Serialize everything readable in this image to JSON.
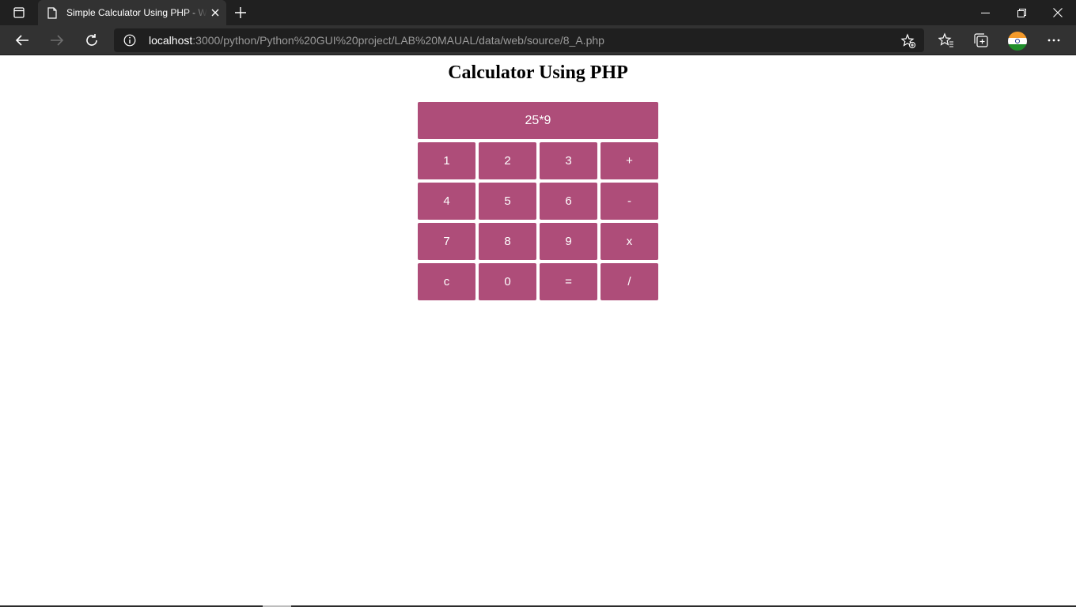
{
  "browser": {
    "tab_title": "Simple Calculator Using PHP - W",
    "url_host": "localhost",
    "url_rest": ":3000/python/Python%20GUI%20project/LAB%20MAUAL/data/web/source/8_A.php"
  },
  "page": {
    "title": "Calculator Using PHP"
  },
  "calculator": {
    "display": "25*9",
    "keys": [
      "1",
      "2",
      "3",
      "+",
      "4",
      "5",
      "6",
      "-",
      "7",
      "8",
      "9",
      "x",
      "c",
      "0",
      "=",
      "/"
    ],
    "accent_color": "#ae4d79"
  }
}
